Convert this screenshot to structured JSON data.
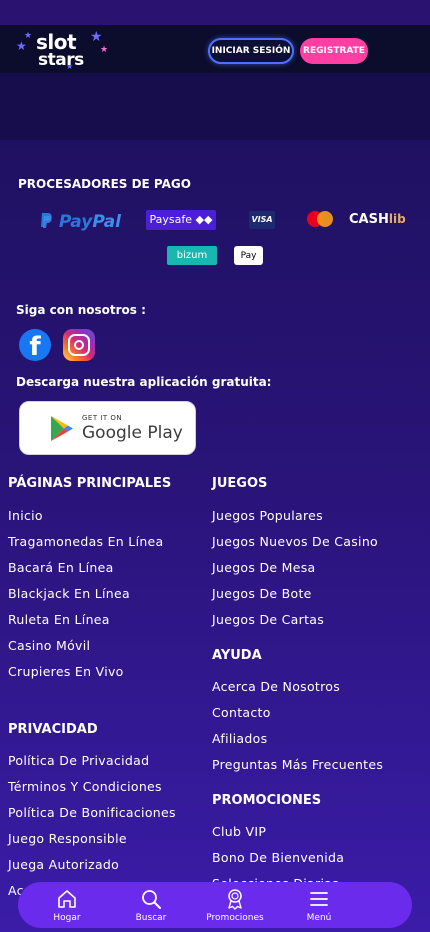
{
  "header": {
    "logo_line1": "slot",
    "logo_line2": "stars",
    "login_label": "INICIAR SESIÓN",
    "register_label": "REGISTRATE"
  },
  "payments": {
    "title": "PROCESADORES DE PAGO",
    "paypal_a": "Pay",
    "paypal_b": "Pal",
    "paysafe": "Paysafe ◆◆",
    "visa": "VISA",
    "cashlib_a": "CASH",
    "cashlib_b": "lib",
    "bizum": "bizum",
    "applepay": " Pay"
  },
  "social": {
    "title": "Siga con nosotros :",
    "facebook_glyph": "f"
  },
  "app": {
    "title": "Descarga nuestra aplicación gratuita:",
    "get_it_on": "GET IT ON",
    "store": "Google Play"
  },
  "main_pages": {
    "title": "PÁGINAS PRINCIPALES",
    "links": [
      "Inicio",
      "Tragamonedas En Línea",
      "Bacará En Línea",
      "Blackjack En Línea",
      "Ruleta En Línea",
      "Casino Móvil",
      "Crupieres En Vivo"
    ]
  },
  "games": {
    "title": "JUEGOS",
    "links": [
      "Juegos Populares",
      "Juegos Nuevos De Casino",
      "Juegos De Mesa",
      "Juegos De Bote",
      "Juegos De Cartas"
    ]
  },
  "help": {
    "title": "AYUDA",
    "links": [
      "Acerca De Nosotros",
      "Contacto",
      "Afiliados",
      "Preguntas Más Frecuentes"
    ]
  },
  "privacy": {
    "title": "PRIVACIDAD",
    "links": [
      "Política De Privacidad",
      "Términos Y Condiciones",
      "Política De Bonificaciones",
      "Juego Responsible",
      "Juega Autorizado",
      "Ac"
    ]
  },
  "promotions": {
    "title": "PROMOCIONES",
    "links": [
      "Club VIP",
      "Bono De Bienvenida",
      "Selecciones Diarias"
    ]
  },
  "bottom_nav": {
    "items": [
      {
        "label": "Hogar",
        "icon": "home-icon"
      },
      {
        "label": "Buscar",
        "icon": "search-icon"
      },
      {
        "label": "Promociones",
        "icon": "award-icon"
      },
      {
        "label": "Menú",
        "icon": "menu-icon"
      }
    ]
  },
  "colors": {
    "accent_purple": "#6b2bec",
    "register_pink": "#ff3fa3",
    "login_blue": "#4d71ff"
  }
}
